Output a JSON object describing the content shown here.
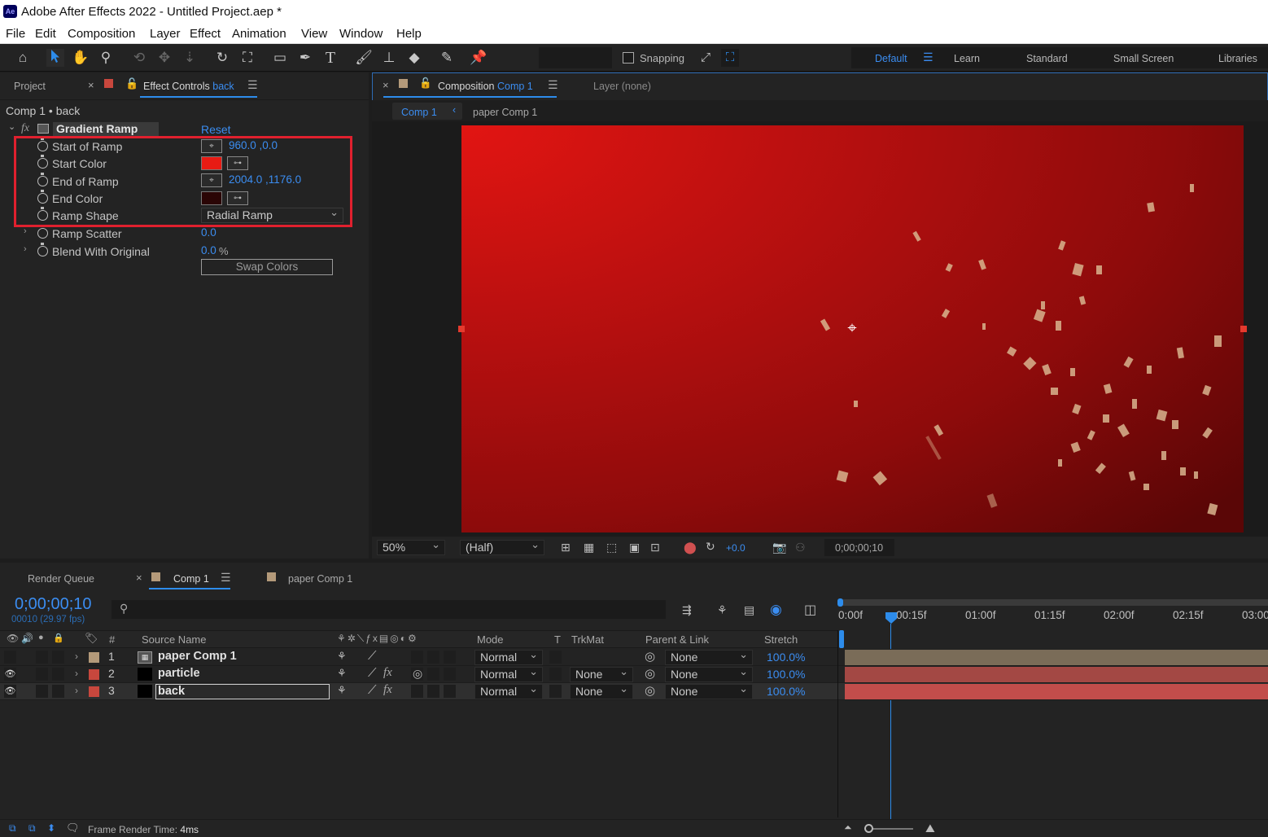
{
  "window": {
    "app_icon": "Ae",
    "title": "Adobe After Effects 2022 - Untitled Project.aep *"
  },
  "menu": [
    "File",
    "Edit",
    "Composition",
    "Layer",
    "Effect",
    "Animation",
    "View",
    "Window",
    "Help"
  ],
  "toolbar": {
    "tools": [
      "home-icon",
      "selection-tool-icon",
      "hand-tool-icon",
      "zoom-tool-icon",
      "orbit-camera-icon",
      "pan-camera-icon",
      "dolly-camera-icon",
      "rotate-tool-icon",
      "pan-behind-icon",
      "rectangle-tool-icon",
      "pen-tool-icon",
      "type-tool-icon",
      "brush-tool-icon",
      "clone-stamp-icon",
      "eraser-tool-icon",
      "roto-brush-icon",
      "puppet-pin-icon"
    ],
    "snapping_label": "Snapping",
    "workspaces": [
      "Default",
      "Learn",
      "Standard",
      "Small Screen",
      "Libraries"
    ],
    "active_workspace": "Default"
  },
  "left_panel": {
    "tabs": {
      "project": "Project",
      "effect_controls": "Effect Controls",
      "effect_controls_layer": "back"
    },
    "breadcrumb": "Comp 1 • back",
    "effect": {
      "fx": "fx",
      "name": "Gradient Ramp",
      "reset": "Reset"
    },
    "properties": [
      {
        "label": "Start of Ramp",
        "value": "960.0 ,0.0",
        "kind": "point"
      },
      {
        "label": "Start Color",
        "color": "#e81b14",
        "kind": "color"
      },
      {
        "label": "End of Ramp",
        "value": "2004.0 ,1176.0",
        "kind": "point"
      },
      {
        "label": "End Color",
        "color": "#2a0505",
        "kind": "color"
      },
      {
        "label": "Ramp Shape",
        "value": "Radial Ramp",
        "kind": "dropdown"
      },
      {
        "label": "Ramp Scatter",
        "value": "0.0",
        "kind": "number"
      },
      {
        "label": "Blend With Original",
        "value": "0.0",
        "unit": "%",
        "kind": "number"
      }
    ],
    "swap_button": "Swap Colors",
    "highlight_color": "#e0202e"
  },
  "comp_panel": {
    "tab_label": "Composition",
    "tab_comp": "Comp 1",
    "layer_tab": "Layer (none)",
    "sub_tabs": [
      "Comp 1",
      "paper Comp 1"
    ],
    "zoom": "50%",
    "resolution": "(Half)",
    "exposure": "+0.0",
    "timecode": "0;00;00;10",
    "bg_start": "#e21512",
    "bg_end": "#5a0606"
  },
  "timeline": {
    "tabs": [
      "Render Queue",
      "Comp 1",
      "paper Comp 1"
    ],
    "timecode": "0;00;00;10",
    "frame_info": "00010 (29.97 fps)",
    "search_placeholder": "",
    "headers": {
      "hash": "#",
      "source": "Source Name",
      "mode": "Mode",
      "t": "T",
      "trkmat": "TrkMat",
      "parent": "Parent & Link",
      "stretch": "Stretch"
    },
    "layers": [
      {
        "num": "1",
        "name": "paper Comp 1",
        "label_color": "#b49a7a",
        "mode": "Normal",
        "trkmat": "",
        "parent": "None",
        "stretch": "100.0%",
        "fx": "",
        "visible": false,
        "selected": false,
        "bar_color": "#7a6c58"
      },
      {
        "num": "2",
        "name": "particle",
        "label_color": "#c8473d",
        "mode": "Normal",
        "trkmat": "None",
        "parent": "None",
        "stretch": "100.0%",
        "fx": "fx",
        "visible": true,
        "selected": false,
        "bar_color": "#a34844"
      },
      {
        "num": "3",
        "name": "back",
        "label_color": "#c8473d",
        "mode": "Normal",
        "trkmat": "None",
        "parent": "None",
        "stretch": "100.0%",
        "fx": "fx",
        "visible": true,
        "selected": true,
        "bar_color": "#c24d4b"
      }
    ],
    "ruler": [
      "0:00f",
      "00:15f",
      "01:00f",
      "01:15f",
      "02:00f",
      "02:15f",
      "03:00"
    ],
    "status_label": "Frame Render Time:",
    "status_value": "4ms"
  }
}
